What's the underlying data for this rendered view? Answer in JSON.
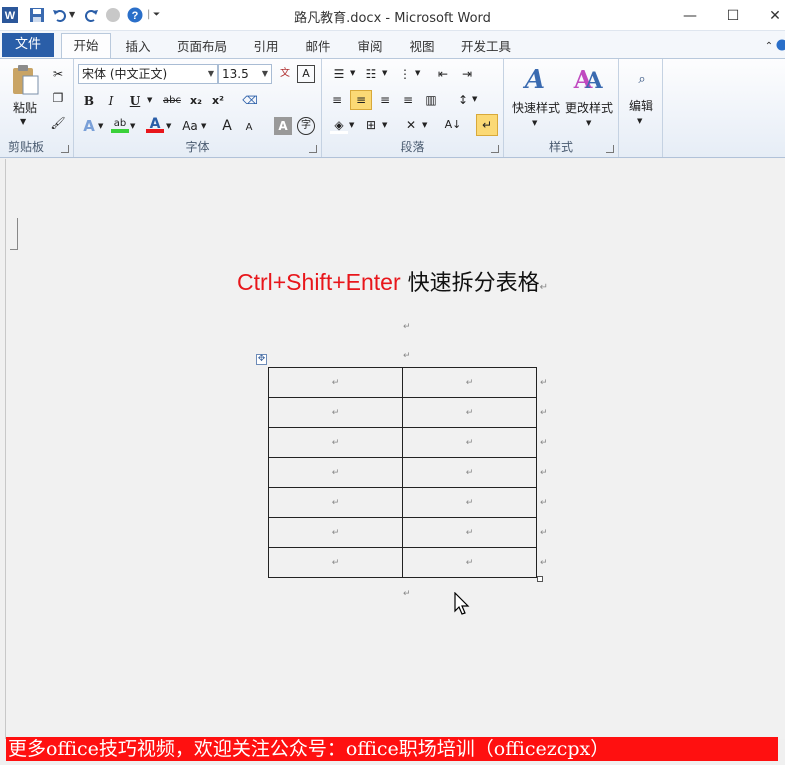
{
  "window": {
    "title": "路凡教育.docx - Microsoft Word",
    "minimize": "—",
    "maximize": "☐",
    "close": "✕"
  },
  "tabs": {
    "file": "文件",
    "items": [
      "开始",
      "插入",
      "页面布局",
      "引用",
      "邮件",
      "审阅",
      "视图",
      "开发工具"
    ]
  },
  "ribbon": {
    "clipboard": {
      "paste": "粘贴",
      "label": "剪贴板"
    },
    "font": {
      "name": "宋体 (中文正文)",
      "size": "13.5",
      "label": "字体",
      "bold": "B",
      "italic": "I",
      "underline": "U",
      "strike": "abc",
      "sub": "x₂",
      "sup": "x²",
      "case": "Aa",
      "grow": "A",
      "shrink": "A"
    },
    "paragraph": {
      "label": "段落"
    },
    "styles": {
      "quick": "快速样式",
      "change": "更改样式",
      "label": "样式"
    },
    "editing": {
      "label": "编辑"
    }
  },
  "document": {
    "title_red": "Ctrl+Shift+Enter",
    "title_black": " 快速拆分表格",
    "para_mark": "↵",
    "table": {
      "rows": [
        [
          "↵",
          "↵"
        ],
        [
          "↵",
          "↵"
        ],
        [
          "↵",
          "↵"
        ],
        [
          "↵",
          "↵"
        ],
        [
          "↵",
          "↵"
        ],
        [
          "↵",
          "↵"
        ],
        [
          "↵",
          "↵"
        ]
      ]
    }
  },
  "banner": "更多office技巧视频，欢迎关注公众号：office职场培训（officezcpx）",
  "colors": {
    "file_tab": "#2a5ea8",
    "title_red": "#e8161b",
    "banner": "#ff1010"
  }
}
